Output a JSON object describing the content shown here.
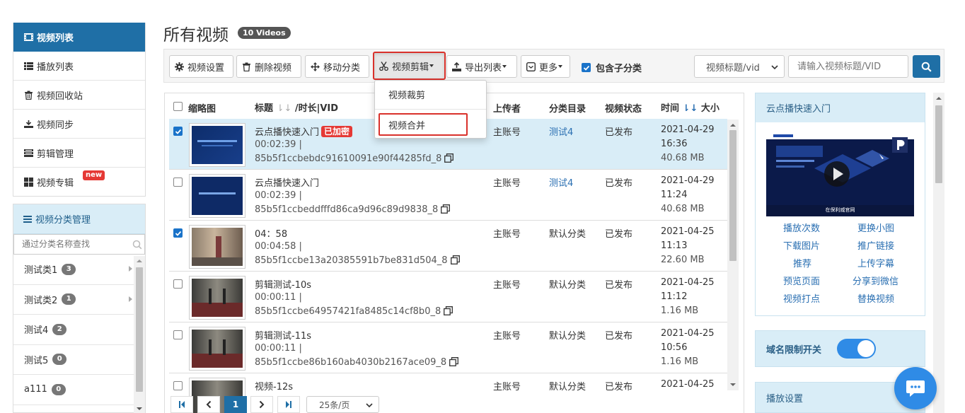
{
  "sidebar": {
    "items": [
      {
        "label": "视频列表",
        "icon": "film-icon",
        "active": true
      },
      {
        "label": "播放列表",
        "icon": "list-icon"
      },
      {
        "label": "视频回收站",
        "icon": "trash-icon"
      },
      {
        "label": "视频同步",
        "icon": "sync-icon"
      },
      {
        "label": "剪辑管理",
        "icon": "clip-icon"
      },
      {
        "label": "视频专辑",
        "icon": "grid-icon",
        "badge": "new"
      }
    ]
  },
  "categories": {
    "title": "视频分类管理",
    "search_placeholder": "通过分类名称查找",
    "items": [
      {
        "name": "测试类1",
        "count": "3"
      },
      {
        "name": "测试类2",
        "count": "1"
      },
      {
        "name": "测试4",
        "count": "2"
      },
      {
        "name": "测试5",
        "count": "0"
      },
      {
        "name": "a111",
        "count": "0"
      }
    ]
  },
  "page": {
    "title": "所有视频",
    "count_badge": "10 Videos"
  },
  "toolbar": {
    "settings": "视频设置",
    "delete": "删除视频",
    "move": "移动分类",
    "edit": "视频剪辑",
    "export": "导出列表",
    "more": "更多",
    "include_sub": "包含子分类",
    "search_field": "视频标题/vid",
    "search_placeholder": "请输入视频标题/VID"
  },
  "dropdown": {
    "crop": "视频裁剪",
    "merge": "视频合并"
  },
  "table": {
    "headers": {
      "thumb": "缩略图",
      "title": "标题",
      "duration_vid": "/时长|VID",
      "uploader": "上传者",
      "category": "分类目录",
      "status": "视频状态",
      "time": "时间",
      "size": "大小"
    },
    "rows": [
      {
        "title": "云点播快速入门",
        "encrypted": "已加密",
        "duration": "00:02:39 |",
        "vid": "85b5f1ccbebdc91610091e90f44285fd_8",
        "uploader": "主账号",
        "category": "测试4",
        "status": "已发布",
        "date": "2021-04-29",
        "time": "16:36",
        "size": "40.68 MB"
      },
      {
        "title": "云点播快速入门",
        "duration": "00:02:39 |",
        "vid": "85b5f1ccbeddfffd86ca9d96c89d9838_8",
        "uploader": "主账号",
        "category": "测试4",
        "status": "已发布",
        "date": "2021-04-29",
        "time": "11:24",
        "size": "40.68 MB"
      },
      {
        "title": "04：58",
        "duration": "00:04:58 |",
        "vid": "85b5f1ccbe13a20385591b7be831d504_8",
        "uploader": "主账号",
        "category": "默认分类",
        "status": "已发布",
        "date": "2021-04-25",
        "time": "11:13",
        "size": "22.60 MB"
      },
      {
        "title": "剪辑测试-10s",
        "duration": "00:00:11 |",
        "vid": "85b5f1ccbe64957421fa8485c14cf8b0_8",
        "uploader": "主账号",
        "category": "默认分类",
        "status": "已发布",
        "date": "2021-04-25",
        "time": "11:12",
        "size": "1.16 MB"
      },
      {
        "title": "剪辑测试-11s",
        "duration": "00:00:11 |",
        "vid": "85b5f1ccbe86b160ab4030b2167ace09_8",
        "uploader": "主账号",
        "category": "默认分类",
        "status": "已发布",
        "date": "2021-04-25",
        "time": "10:56",
        "size": "1.16 MB"
      },
      {
        "title": "视频-12s",
        "uploader": "主账号",
        "category": "默认分类",
        "status": "已发布",
        "date": "2021-04-25"
      }
    ]
  },
  "pager": {
    "current": "1",
    "per_page": "25条/页"
  },
  "right_panel": {
    "video_title": "云点播快速入门",
    "links": [
      "播放次数",
      "更换小图",
      "下载图片",
      "推广链接",
      "推荐",
      "上传字幕",
      "预览页面",
      "分享到微信",
      "视频打点",
      "替换视频"
    ],
    "domain_limit": "域名限制开关",
    "play_settings": "播放设置",
    "thumb_caption": "在保利威官网"
  },
  "colors": {
    "primary": "#1f6fa6",
    "highlight": "#d9312b",
    "row_selected": "#d9edf7",
    "link": "#2a6fb2",
    "toggle": "#2f8be6"
  }
}
